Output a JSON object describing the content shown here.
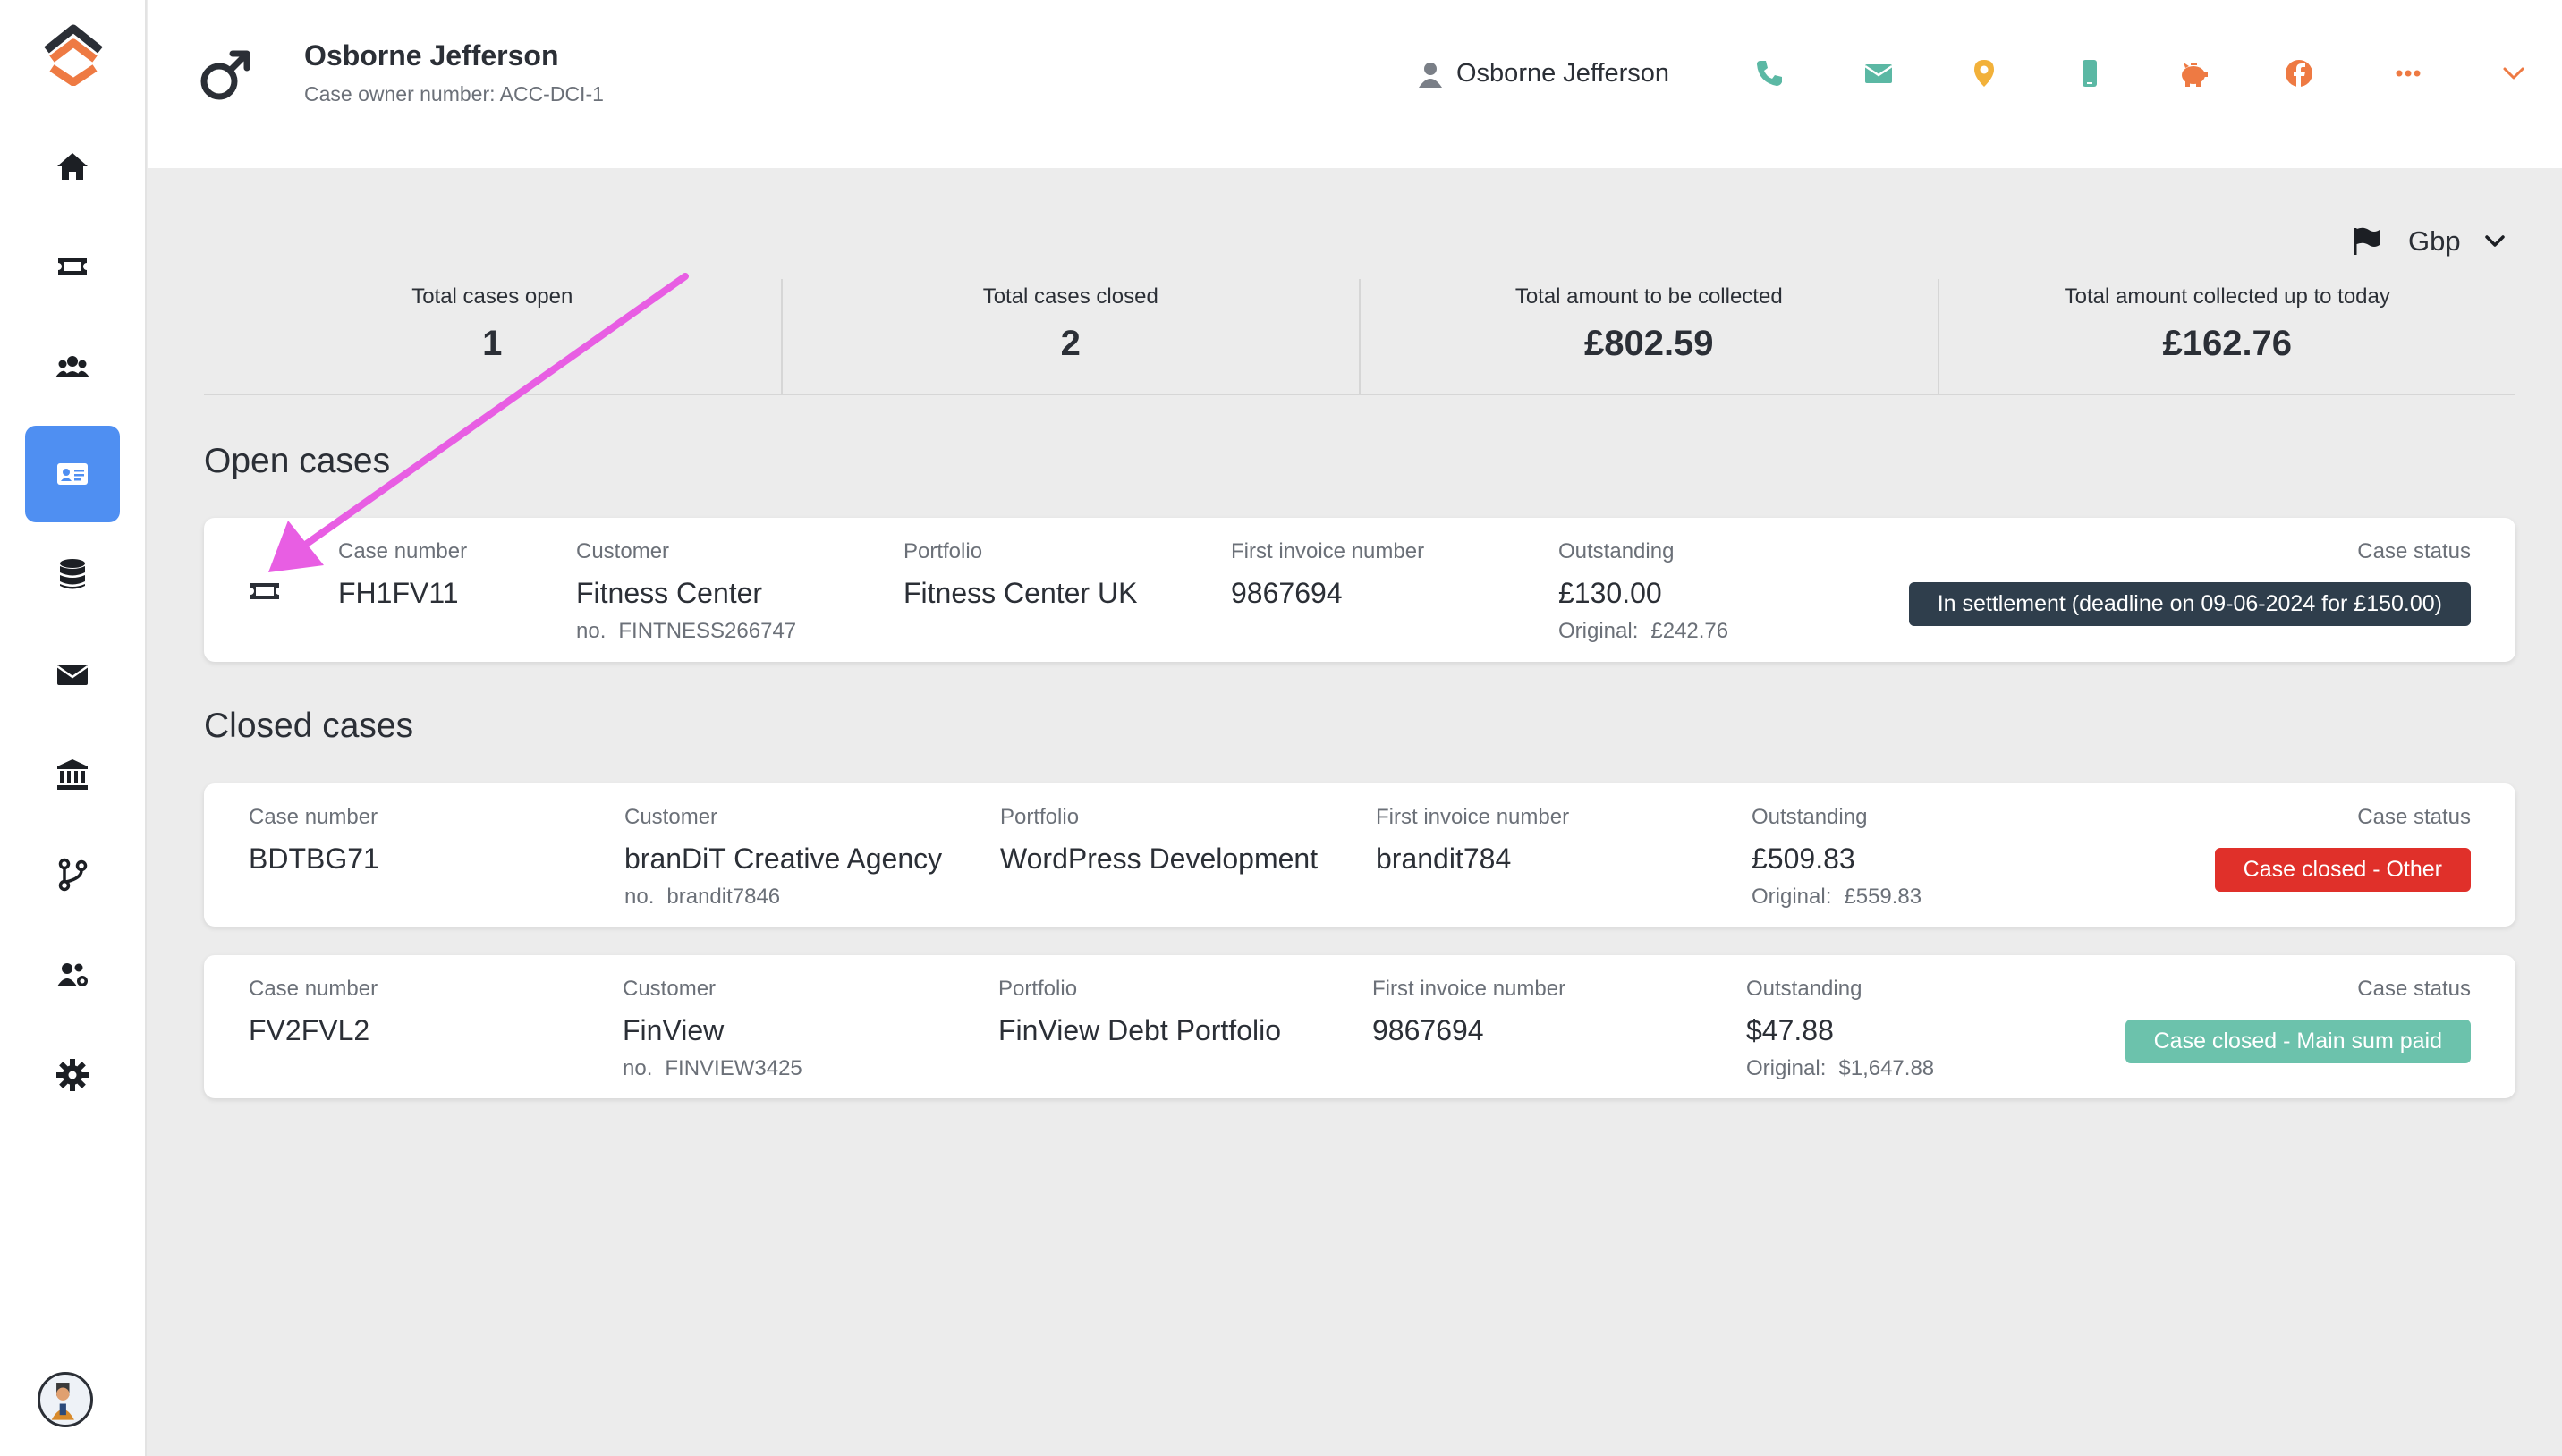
{
  "header": {
    "name": "Osborne Jefferson",
    "subtitle": "Case owner number: ACC-DCI-1",
    "user_name": "Osborne Jefferson",
    "contact_icons": [
      "phone-icon",
      "email-icon",
      "location-icon",
      "mobile-icon",
      "piggy-bank-icon",
      "facebook-icon",
      "more-icon",
      "chevron-down-icon"
    ]
  },
  "sidebar": {
    "items": [
      "home-icon",
      "ticket-icon",
      "users-icon",
      "id-card-icon",
      "database-icon",
      "envelope-icon",
      "bank-icon",
      "branch-icon",
      "team-icon",
      "settings-icon"
    ],
    "active_index": 3
  },
  "currency": {
    "label": "Gbp"
  },
  "stats": [
    {
      "label": "Total cases open",
      "value": "1"
    },
    {
      "label": "Total cases closed",
      "value": "2"
    },
    {
      "label": "Total amount to be collected",
      "value": "£802.59"
    },
    {
      "label": "Total amount collected up to today",
      "value": "£162.76"
    }
  ],
  "labels": {
    "case_number": "Case number",
    "customer": "Customer",
    "portfolio": "Portfolio",
    "first_invoice": "First invoice number",
    "outstanding": "Outstanding",
    "case_status": "Case status",
    "no_prefix": "no.",
    "original_prefix": "Original:"
  },
  "open_cases": {
    "title": "Open cases",
    "items": [
      {
        "case_number": "FH1FV11",
        "customer": "Fitness Center",
        "customer_no": "FINTNESS266747",
        "portfolio": "Fitness Center UK",
        "first_invoice": "9867694",
        "outstanding": "£130.00",
        "original": "£242.76",
        "status": "In settlement (deadline on 09-06-2024 for £150.00)",
        "status_color": "#2f3e4c"
      }
    ]
  },
  "closed_cases": {
    "title": "Closed cases",
    "items": [
      {
        "case_number": "BDTBG71",
        "customer": "branDiT Creative Agency",
        "customer_no": "brandit7846",
        "portfolio": "WordPress Development",
        "first_invoice": "brandit784",
        "outstanding": "£509.83",
        "original": "£559.83",
        "status": "Case closed - Other",
        "status_color": "#e0302a"
      },
      {
        "case_number": "FV2FVL2",
        "customer": "FinView",
        "customer_no": "FINVIEW3425",
        "portfolio": "FinView Debt Portfolio",
        "first_invoice": "9867694",
        "outstanding": "$47.88",
        "original": "$1,647.88",
        "status": "Case closed - Main sum paid",
        "status_color": "#6cc2ac"
      }
    ]
  },
  "colors": {
    "accent": "#4f8ff2",
    "annotation_arrow": "#e85ee3",
    "phone": "#5bb8a4",
    "location": "#f2b13a",
    "orange": "#ee7a43"
  }
}
